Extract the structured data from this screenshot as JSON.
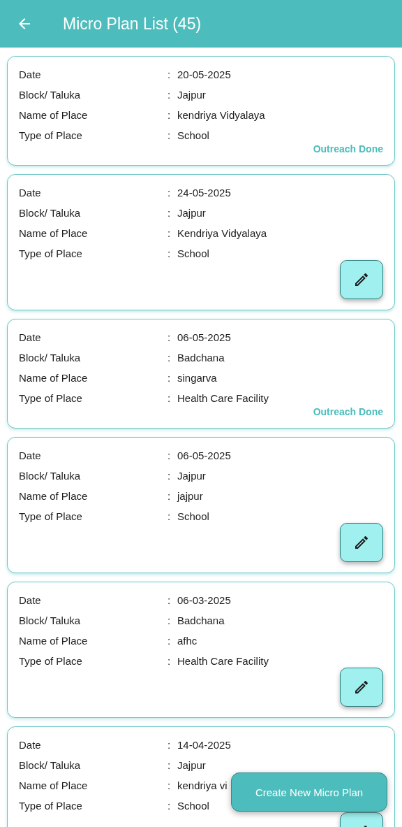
{
  "header": {
    "title": "Micro Plan List (45)"
  },
  "plans": [
    {
      "kind": "outreach_done",
      "status": "Outreach Done",
      "rows": [
        {
          "label": "Date",
          "sep": ":",
          "value": "20-05-2025"
        },
        {
          "label": "Block/ Taluka",
          "sep": ":",
          "value": "Jajpur"
        },
        {
          "label": "Name of Place",
          "sep": ":",
          "value": "kendriya Vidyalaya"
        },
        {
          "label": "Type of Place",
          "sep": ":",
          "value": "School"
        }
      ]
    },
    {
      "kind": "editable",
      "rows": [
        {
          "label": "Date",
          "sep": ":",
          "value": "24-05-2025"
        },
        {
          "label": "Block/ Taluka",
          "sep": ":",
          "value": "Jajpur"
        },
        {
          "label": "Name of Place",
          "sep": ":",
          "value": "Kendriya Vidyalaya"
        },
        {
          "label": "Type of Place",
          "sep": ":",
          "value": "School"
        }
      ]
    },
    {
      "kind": "outreach_done",
      "status": "Outreach Done",
      "rows": [
        {
          "label": "Date",
          "sep": ":",
          "value": "06-05-2025"
        },
        {
          "label": "Block/ Taluka",
          "sep": ":",
          "value": "Badchana"
        },
        {
          "label": "Name of Place",
          "sep": ":",
          "value": "singarva"
        },
        {
          "label": "Type of Place",
          "sep": ":",
          "value": "Health Care Facility"
        }
      ]
    },
    {
      "kind": "editable",
      "rows": [
        {
          "label": "Date",
          "sep": ":",
          "value": "06-05-2025"
        },
        {
          "label": "Block/ Taluka",
          "sep": ":",
          "value": "Jajpur"
        },
        {
          "label": "Name of Place",
          "sep": ":",
          "value": "jajpur"
        },
        {
          "label": "Type of Place",
          "sep": ":",
          "value": "School"
        }
      ]
    },
    {
      "kind": "editable",
      "rows": [
        {
          "label": "Date",
          "sep": ":",
          "value": "06-03-2025"
        },
        {
          "label": "Block/ Taluka",
          "sep": ":",
          "value": "Badchana"
        },
        {
          "label": "Name of Place",
          "sep": ":",
          "value": "afhc"
        },
        {
          "label": "Type of Place",
          "sep": ":",
          "value": "Health Care Facility"
        }
      ]
    },
    {
      "kind": "editable",
      "rows": [
        {
          "label": "Date",
          "sep": ":",
          "value": "14-04-2025"
        },
        {
          "label": "Block/ Taluka",
          "sep": ":",
          "value": "Jajpur"
        },
        {
          "label": "Name of Place",
          "sep": ":",
          "value": "kendriya vi"
        },
        {
          "label": "Type of Place",
          "sep": ":",
          "value": "School"
        }
      ]
    }
  ],
  "create_button": {
    "label": "Create New Micro Plan"
  }
}
